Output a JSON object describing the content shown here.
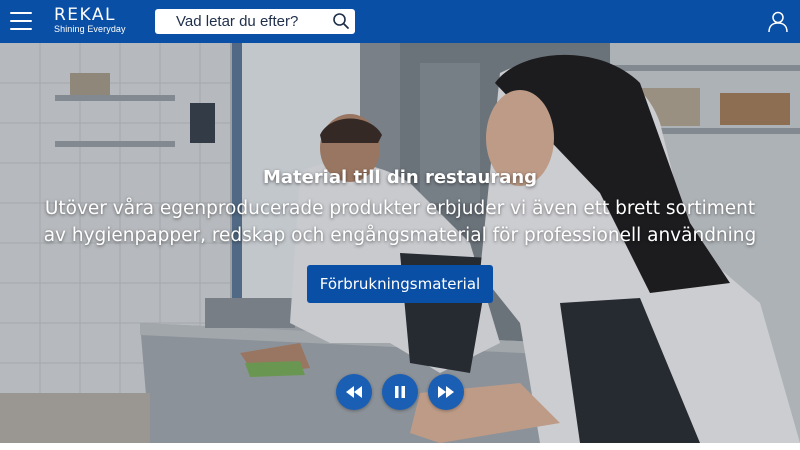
{
  "header": {
    "brand": {
      "name": "REKAL",
      "tagline": "Shining Everyday"
    },
    "menu_icon": "hamburger-menu-icon",
    "search": {
      "placeholder": "Vad letar du efter?",
      "icon": "search-icon"
    },
    "account_icon": "user-icon",
    "background_color": "#0a4fa6"
  },
  "hero": {
    "title": "Material till din restaurang",
    "subtitle_line1": "Utöver våra egenproducerade produkter erbjuder vi även ett brett sortiment",
    "subtitle_line2": "av hygienpapper, redskap och engångsmaterial för professionell användning",
    "cta_label": "Förbrukningsmaterial",
    "cta_color": "#0a4fa6",
    "carousel_controls": {
      "previous_icon": "rewind-icon",
      "pause_icon": "pause-icon",
      "next_icon": "fast-forward-icon",
      "button_color": "#1a5fb4"
    }
  }
}
